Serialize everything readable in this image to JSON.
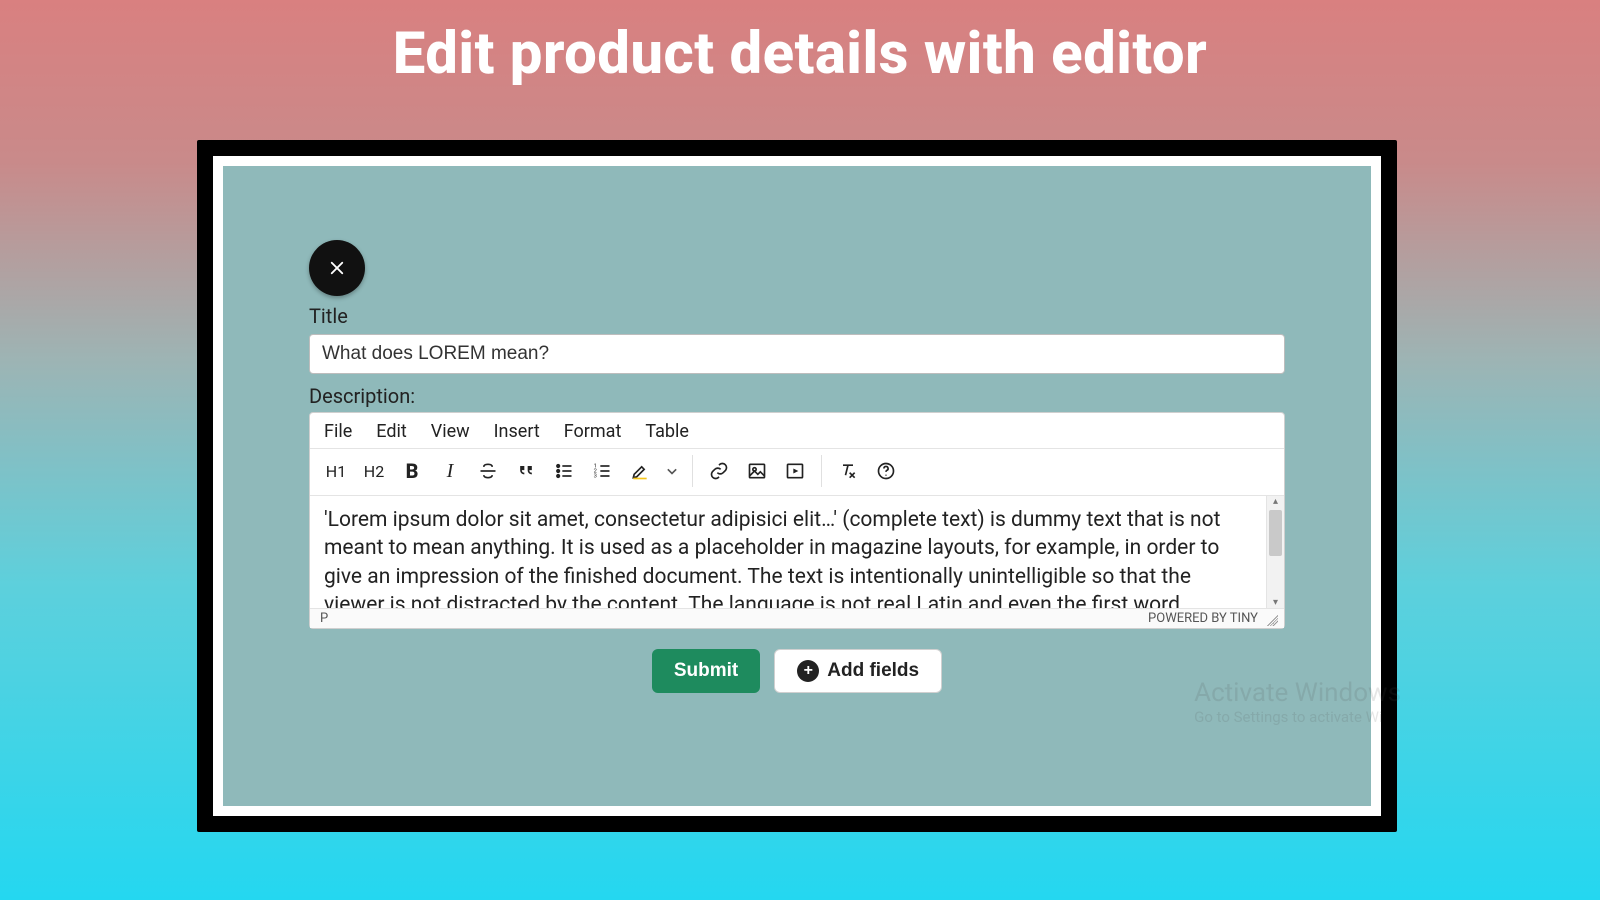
{
  "page": {
    "heading": "Edit product details with editor"
  },
  "form": {
    "title_label": "Title",
    "title_value": "What does LOREM mean?",
    "description_label": "Description:"
  },
  "editor": {
    "menu": {
      "file": "File",
      "edit": "Edit",
      "view": "View",
      "insert": "Insert",
      "format": "Format",
      "table": "Table"
    },
    "tool": {
      "h1": "H1",
      "h2": "H2",
      "bold": "B",
      "italic": "I"
    },
    "content": "'Lorem ipsum dolor sit amet, consectetur adipisici elit…' (complete text) is dummy text that is not meant to mean anything. It is used as a placeholder in magazine layouts, for example, in order to give an impression of the finished document. The text is intentionally unintelligible so that the viewer is not distracted by the content. The language is not real Latin and even the first word",
    "status_path": "P",
    "powered": "POWERED BY TINY"
  },
  "actions": {
    "submit": "Submit",
    "add_fields": "Add fields"
  },
  "watermark": {
    "line1": "Activate Windows",
    "line2": "Go to Settings to activate Wi"
  }
}
